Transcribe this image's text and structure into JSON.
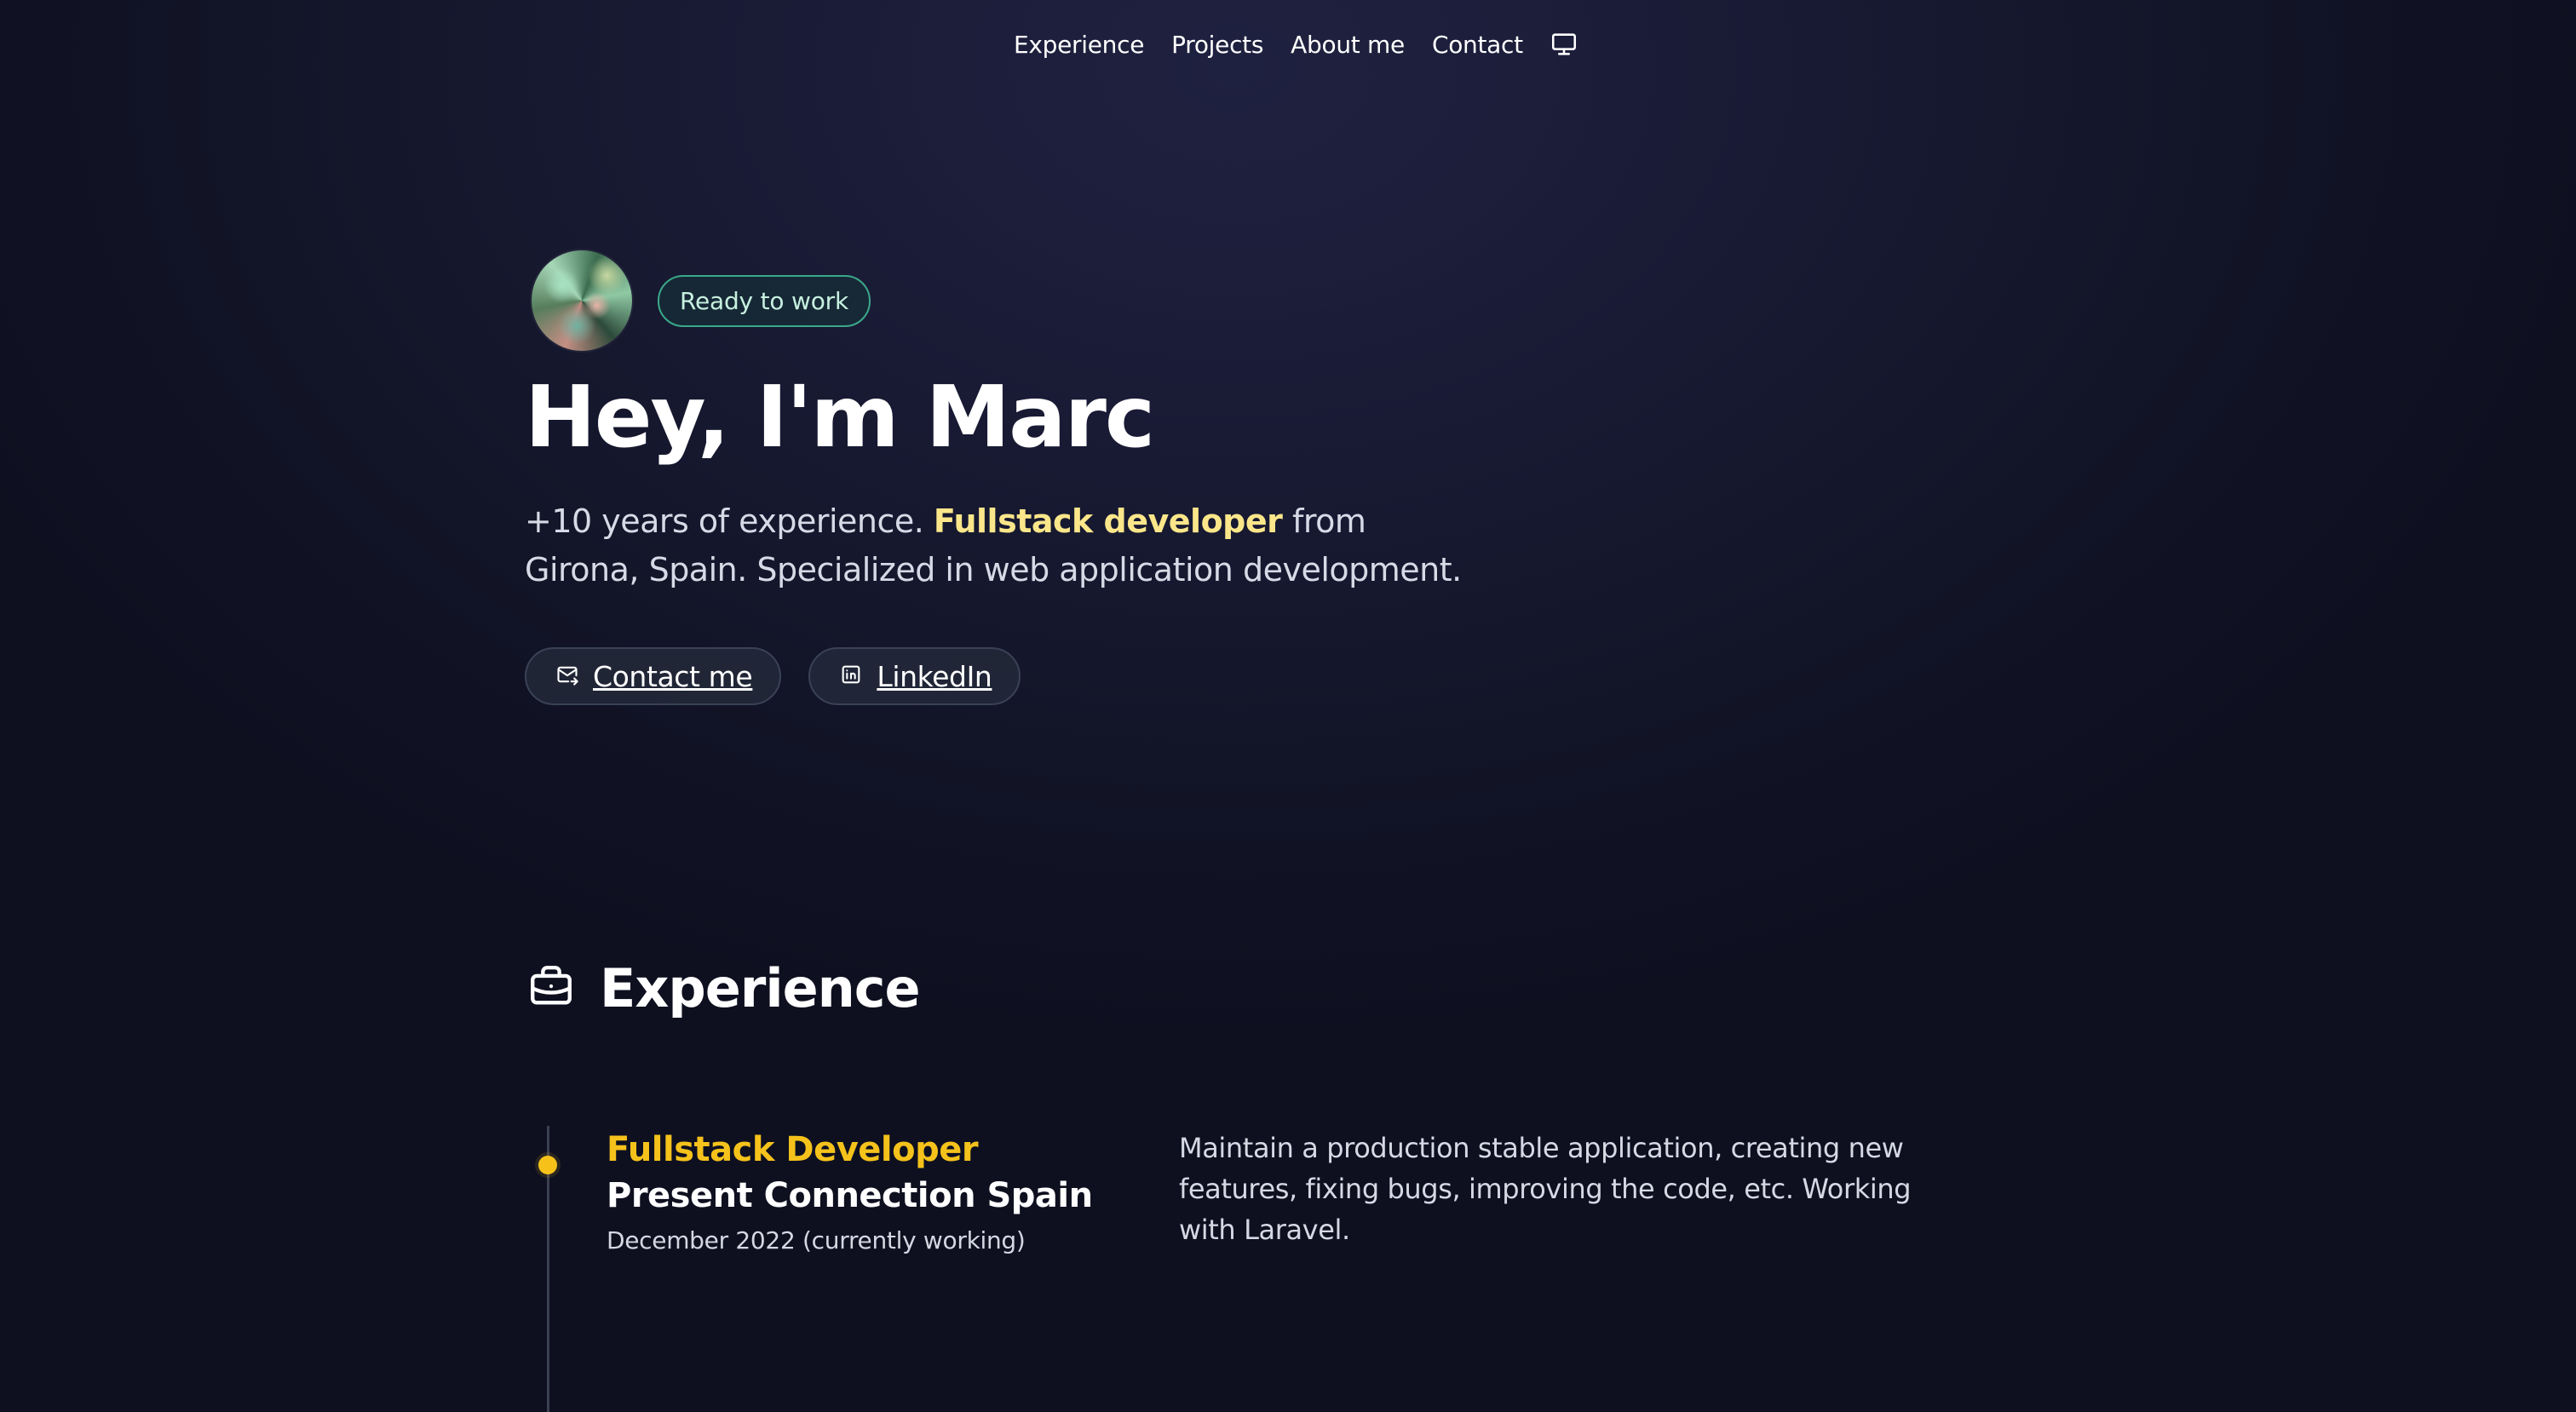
{
  "nav": {
    "items": [
      {
        "label": "Experience"
      },
      {
        "label": "Projects"
      },
      {
        "label": "About me"
      },
      {
        "label": "Contact"
      }
    ],
    "theme_icon": "monitor-icon"
  },
  "hero": {
    "badge": "Ready to work",
    "title": "Hey, I'm Marc",
    "intro_before": "+10 years of experience. ",
    "intro_highlight": "Fullstack developer",
    "intro_after": " from Girona, Spain. Specialized in web application development.",
    "buttons": {
      "contact": {
        "label": "Contact me",
        "icon": "mail-icon"
      },
      "linkedin": {
        "label": "LinkedIn",
        "icon": "linkedin-icon"
      }
    }
  },
  "experience": {
    "title": "Experience",
    "icon": "briefcase-icon",
    "items": [
      {
        "role": "Fullstack Developer",
        "company": "Present Connection Spain",
        "date": "December 2022 (currently working)",
        "description": "Maintain a production stable application, creating new features, fixing bugs, improving the code, etc. Working with Laravel."
      }
    ]
  },
  "colors": {
    "accent_yellow": "#f5c21b",
    "highlight_yellow": "#fbe68a",
    "badge_green": "#3aa98a",
    "background": "#14162b"
  }
}
